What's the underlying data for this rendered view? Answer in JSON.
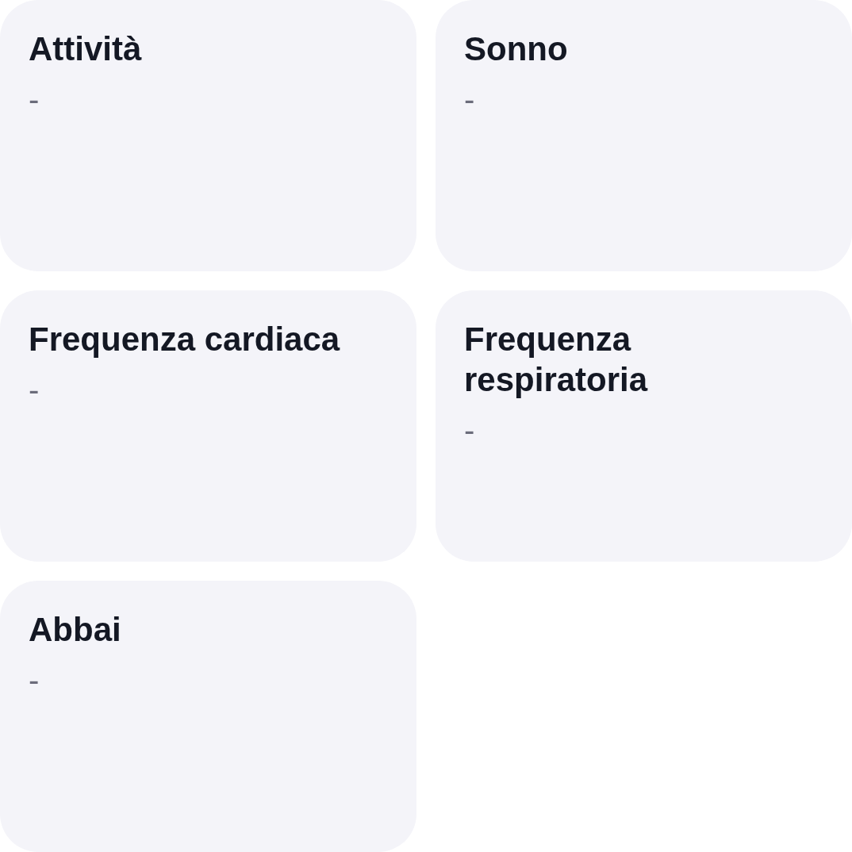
{
  "cards": [
    {
      "title": "Attività",
      "value": "-"
    },
    {
      "title": "Sonno",
      "value": "-"
    },
    {
      "title": "Frequenza cardiaca",
      "value": "-"
    },
    {
      "title": "Frequenza respiratoria",
      "value": "-"
    },
    {
      "title": "Abbai",
      "value": "-"
    }
  ]
}
